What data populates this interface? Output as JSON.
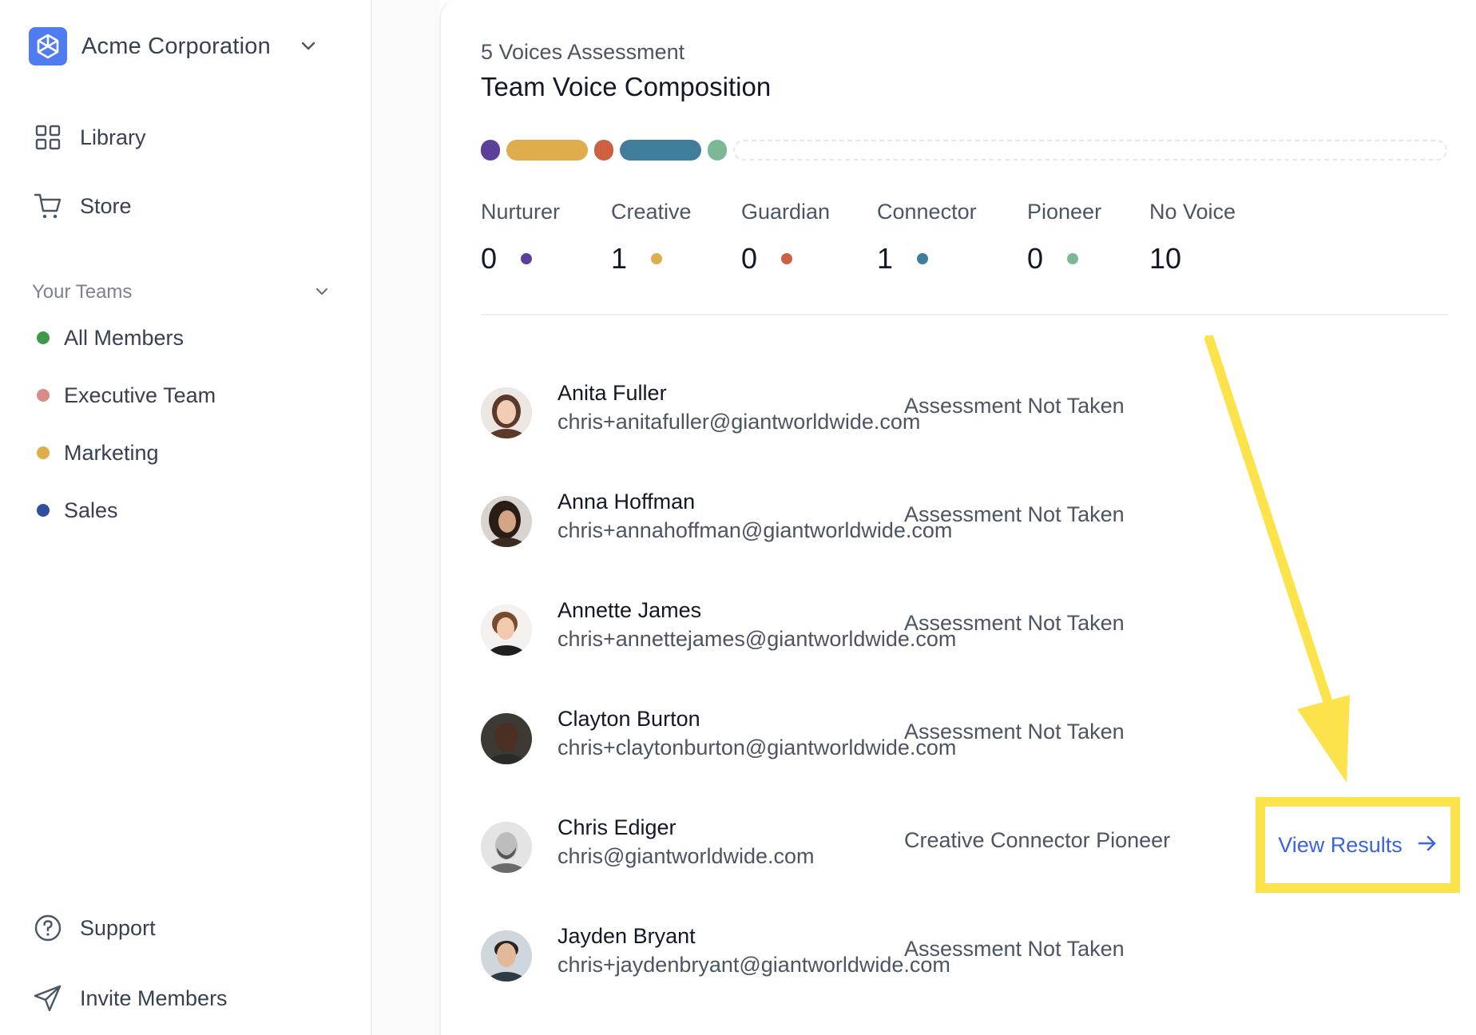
{
  "sidebar": {
    "org_name": "Acme Corporation",
    "org_logo_icon": "cube-logo-icon",
    "nav": [
      {
        "label": "Library",
        "icon": "grid-icon"
      },
      {
        "label": "Store",
        "icon": "cart-icon"
      }
    ],
    "teams_header": "Your Teams",
    "teams": [
      {
        "label": "All Members",
        "color": "#3f9a48"
      },
      {
        "label": "Executive Team",
        "color": "#d98a86"
      },
      {
        "label": "Marketing",
        "color": "#e0ad4d"
      },
      {
        "label": "Sales",
        "color": "#2d4f9e"
      }
    ],
    "footer": [
      {
        "label": "Support",
        "icon": "help-circle-icon"
      },
      {
        "label": "Invite Members",
        "icon": "send-icon"
      }
    ]
  },
  "main": {
    "subtitle": "5 Voices Assessment",
    "title": "Team Voice Composition",
    "voice_bar": {
      "segments": [
        {
          "voice": "Nurturer",
          "color": "#5b3f9b",
          "count": 0
        },
        {
          "voice": "Creative",
          "color": "#e0ad4d",
          "count": 1
        },
        {
          "voice": "Guardian",
          "color": "#cc6040",
          "count": 0
        },
        {
          "voice": "Connector",
          "color": "#3f7d9a",
          "count": 1
        },
        {
          "voice": "Pioneer",
          "color": "#7db896",
          "count": 0
        }
      ],
      "no_voice_count": 10
    },
    "stats": [
      {
        "label": "Nurturer",
        "value": "0",
        "color": "#5b3f9b"
      },
      {
        "label": "Creative",
        "value": "1",
        "color": "#e0ad4d"
      },
      {
        "label": "Guardian",
        "value": "0",
        "color": "#cc6040"
      },
      {
        "label": "Connector",
        "value": "1",
        "color": "#3f7d9a"
      },
      {
        "label": "Pioneer",
        "value": "0",
        "color": "#7db896"
      },
      {
        "label": "No Voice",
        "value": "10",
        "color": ""
      }
    ],
    "members": [
      {
        "name": "Anita Fuller",
        "email": "chris+anitafuller@giantworldwide.com",
        "status": "Assessment Not Taken"
      },
      {
        "name": "Anna Hoffman",
        "email": "chris+annahoffman@giantworldwide.com",
        "status": "Assessment Not Taken"
      },
      {
        "name": "Annette James",
        "email": "chris+annettejames@giantworldwide.com",
        "status": "Assessment Not Taken"
      },
      {
        "name": "Clayton Burton",
        "email": "chris+claytonburton@giantworldwide.com",
        "status": "Assessment Not Taken"
      },
      {
        "name": "Chris Ediger",
        "email": "chris@giantworldwide.com",
        "status": "Creative Connector Pioneer"
      },
      {
        "name": "Jayden Bryant",
        "email": "chris+jaydenbryant@giantworldwide.com",
        "status": "Assessment Not Taken"
      }
    ],
    "view_results": {
      "label": "View Results",
      "icon": "arrow-right-icon"
    },
    "annotation": {
      "color": "#fce34c"
    }
  }
}
